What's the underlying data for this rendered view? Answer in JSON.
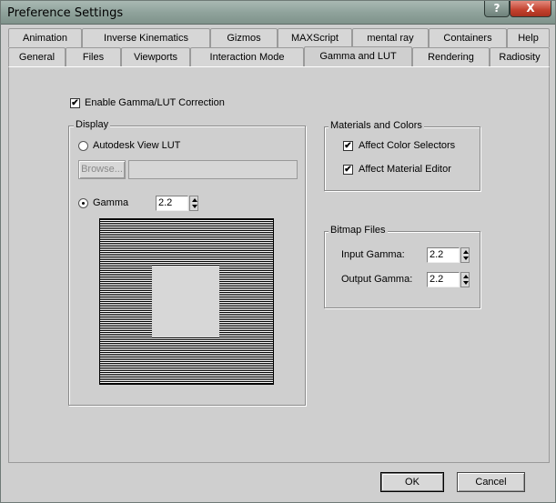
{
  "window": {
    "title": "Preference Settings"
  },
  "titlebar": {
    "help_glyph": "?",
    "close_glyph": "X"
  },
  "tabs": {
    "row1": [
      "Animation",
      "Inverse Kinematics",
      "Gizmos",
      "MAXScript",
      "mental ray",
      "Containers",
      "Help"
    ],
    "row2": [
      "General",
      "Files",
      "Viewports",
      "Interaction Mode",
      "Gamma and LUT",
      "Rendering",
      "Radiosity"
    ],
    "active": "Gamma and LUT"
  },
  "enable": {
    "label": "Enable Gamma/LUT Correction",
    "checked": true,
    "mark": "✔"
  },
  "display": {
    "title": "Display",
    "lut_label": "Autodesk View LUT",
    "browse_label": "Browse...",
    "gamma_label": "Gamma",
    "gamma_value": "2.2",
    "selected": "gamma"
  },
  "materials": {
    "title": "Materials and Colors",
    "color_selectors_label": "Affect Color Selectors",
    "material_editor_label": "Affect Material Editor",
    "mark": "✔"
  },
  "bitmap": {
    "title": "Bitmap Files",
    "input_label": "Input Gamma:",
    "input_value": "2.2",
    "output_label": "Output Gamma:",
    "output_value": "2.2"
  },
  "footer": {
    "ok_label": "OK",
    "cancel_label": "Cancel"
  }
}
